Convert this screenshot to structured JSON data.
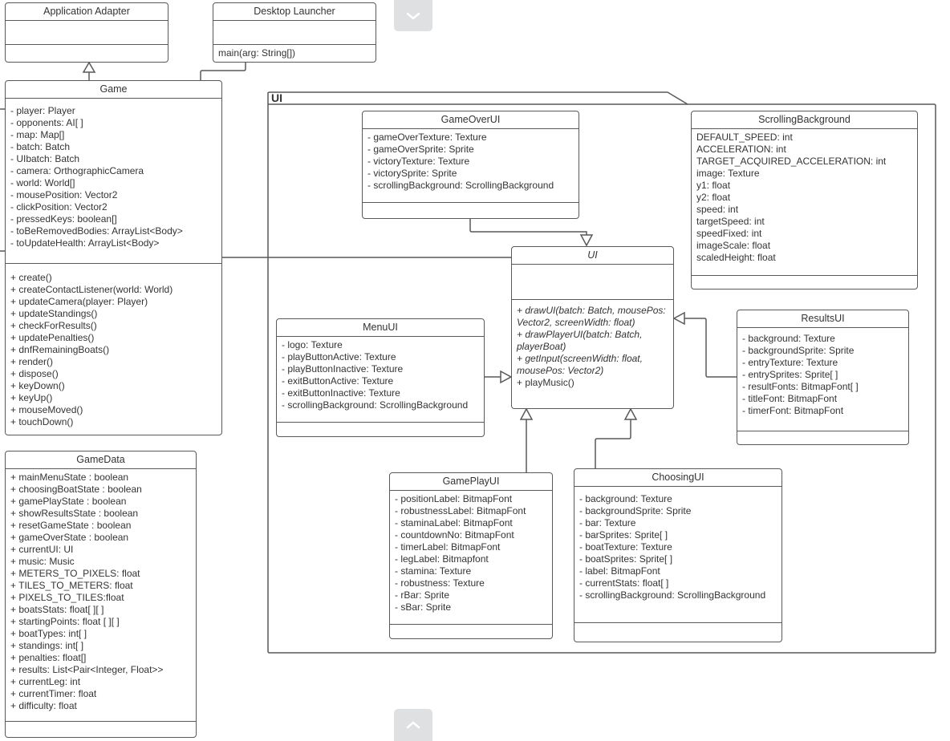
{
  "package": {
    "label": "UI"
  },
  "classes": {
    "application_adapter": {
      "name": "Application Adapter",
      "attributes": [],
      "operations": []
    },
    "desktop_launcher": {
      "name": "Desktop Launcher",
      "attributes": [],
      "operations": [
        "main(arg: String[])"
      ]
    },
    "game": {
      "name": "Game",
      "attributes": [
        "- player: Player",
        "- opponents: AI[ ]",
        "- map: Map[]",
        "- batch: Batch",
        "- UIbatch: Batch",
        "- camera: OrthographicCamera",
        "- world: World[]",
        "- mousePosition: Vector2",
        "- clickPosition: Vector2",
        "- pressedKeys: boolean[]",
        "- toBeRemovedBodies: ArrayList<Body>",
        "- toUpdateHealth: ArrayList<Body>"
      ],
      "operations": [
        "+ create()",
        "+ createContactListener(world: World)",
        "+ updateCamera(player: Player)",
        "+ updateStandings()",
        "+ checkForResults()",
        "+ updatePenalties()",
        "+ dnfRemainingBoats()",
        "+ render()",
        "+ dispose()",
        "+ keyDown()",
        "+ keyUp()",
        "+ mouseMoved()",
        "+ touchDown()"
      ]
    },
    "game_data": {
      "name": "GameData",
      "attributes": [
        "+ mainMenuState : boolean",
        "+ choosingBoatState : boolean",
        "+ gamePlayState : boolean",
        "+ showResultsState : boolean",
        "+ resetGameState : boolean",
        "+ gameOverState : boolean",
        "+ currentUI: UI",
        "+ music: Music",
        "+ METERS_TO_PIXELS: float",
        "+ TILES_TO_METERS: float",
        "+ PIXELS_TO_TILES:float",
        "+ boatsStats: float[ ][ ]",
        "+ startingPoints: float [ ][ ]",
        "+ boatTypes: int[ ]",
        "+ standings: int[ ]",
        "+ penalties: float[]",
        "+ results: List<Pair<Integer, Float>>",
        "+ currentLeg: int",
        "+ currentTimer: float",
        "+ difficulty: float"
      ],
      "operations": []
    },
    "game_over_ui": {
      "name": "GameOverUI",
      "attributes": [
        "- gameOverTexture: Texture",
        "- gameOverSprite: Sprite",
        "- victoryTexture: Texture",
        "- victorySprite: Sprite",
        "- scrollingBackground: ScrollingBackground"
      ],
      "operations": []
    },
    "scrolling_background": {
      "name": "ScrollingBackground",
      "attributes": [
        "DEFAULT_SPEED: int",
        "ACCELERATION: int",
        "TARGET_ACQUIRED_ACCELERATION: int",
        "image: Texture",
        "y1: float",
        "y2: float",
        "speed: int",
        "targetSpeed: int",
        "speedFixed: int",
        "imageScale: float",
        "scaledHeight: float"
      ],
      "operations": []
    },
    "ui": {
      "name": "UI",
      "attributes": [],
      "operations": [
        "+ drawUI(batch: Batch, mousePos: Vector2, screenWidth: float)",
        "+ drawPlayerUI(batch: Batch, playerBoat)",
        "+ getInput(screenWidth: float, mousePos: Vector2)",
        "+ playMusic()"
      ]
    },
    "menu_ui": {
      "name": "MenuUI",
      "attributes": [
        "- logo: Texture",
        "- playButtonActive: Texture",
        "- playButtonInactive: Texture",
        "- exitButtonActive: Texture",
        "- exitButtonInactive: Texture",
        "- scrollingBackground: ScrollingBackground"
      ],
      "operations": []
    },
    "results_ui": {
      "name": "ResultsUI",
      "attributes": [
        "- background: Texture",
        "- backgroundSprite: Sprite",
        "- entryTexture: Texture",
        "- entrySprites: Sprite[ ]",
        "- resultFonts: BitmapFont[ ]",
        "- titleFont: BitmapFont",
        "- timerFont: BitmapFont"
      ],
      "operations": []
    },
    "game_play_ui": {
      "name": "GamePlayUI",
      "attributes": [
        "- positionLabel: BitmapFont",
        "- robustnessLabel: BitmapFont",
        "- staminaLabel: BitmapFont",
        "- countdownNo: BitmapFont",
        "- timerLabel: BitmapFont",
        "- legLabel: Bitmapfont",
        "- stamina: Texture",
        "- robustness: Texture",
        "- rBar: Sprite",
        "- sBar: Sprite"
      ],
      "operations": []
    },
    "choosing_ui": {
      "name": "ChoosingUI",
      "attributes": [
        "- background: Texture",
        "- backgroundSprite: Sprite",
        "- bar: Texture",
        "- barSprites: Sprite[ ]",
        "- boatTexture: Texture",
        "- boatSprites: Sprite[ ]",
        "- label: BitmapFont",
        "- currentStats: float[ ]",
        "- scrollingBackground: ScrollingBackground"
      ],
      "operations": []
    }
  },
  "controls": {
    "scroll_down_icon": "chevron-down",
    "scroll_up_icon": "chevron-up"
  },
  "colors": {
    "stroke": "#595959",
    "text": "#333333",
    "button_bg": "#dfe0e2"
  }
}
